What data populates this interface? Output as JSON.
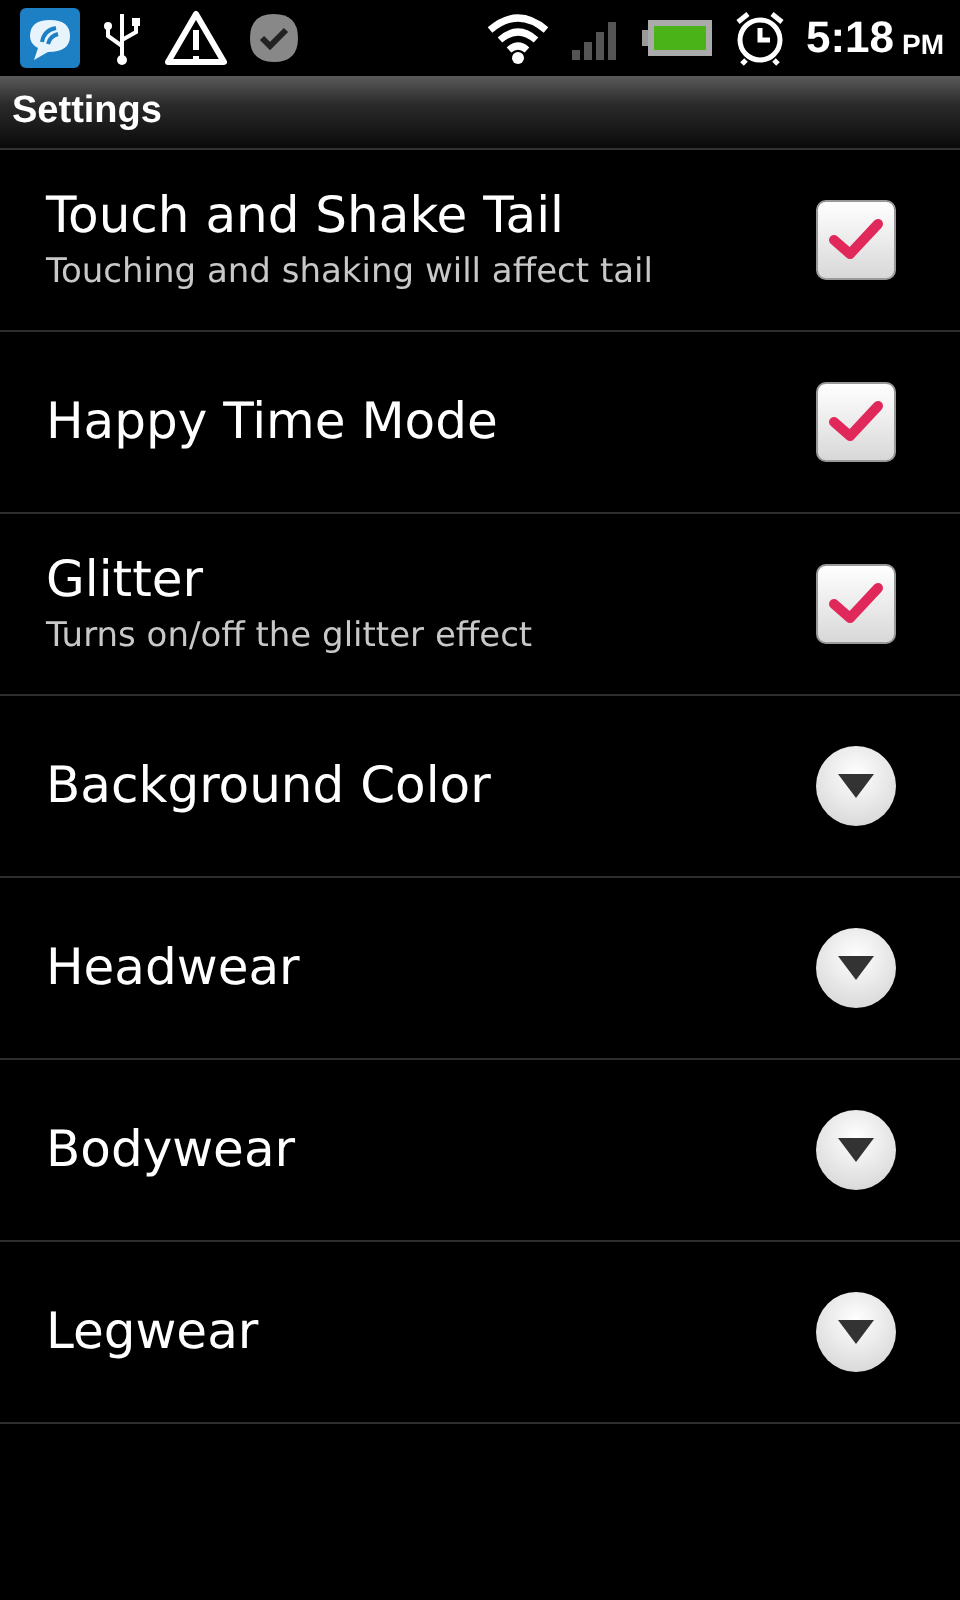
{
  "status_bar": {
    "time": "5:18",
    "meridiem": "PM"
  },
  "title_bar": {
    "title": "Settings"
  },
  "settings": [
    {
      "kind": "checkbox",
      "title": "Touch and Shake Tail",
      "summary": "Touching and shaking will affect tail",
      "checked": true
    },
    {
      "kind": "checkbox",
      "title": "Happy Time Mode",
      "checked": true
    },
    {
      "kind": "checkbox",
      "title": "Glitter",
      "summary": "Turns on/off the glitter effect",
      "checked": true
    },
    {
      "kind": "list",
      "title": "Background Color"
    },
    {
      "kind": "list",
      "title": "Headwear"
    },
    {
      "kind": "list",
      "title": "Bodywear"
    },
    {
      "kind": "list",
      "title": "Legwear"
    }
  ]
}
